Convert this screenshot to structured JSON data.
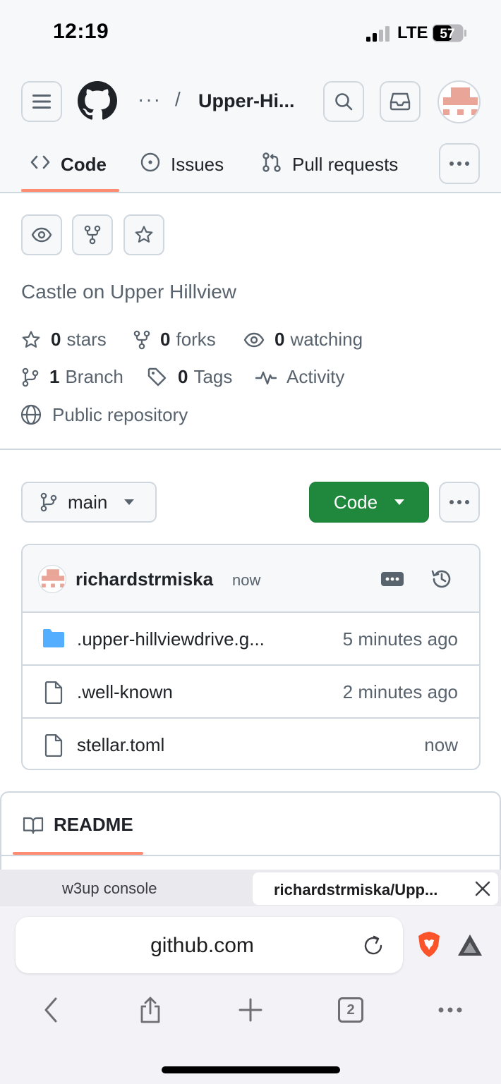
{
  "status_bar": {
    "time": "12:19",
    "network": "LTE",
    "battery": "57"
  },
  "header": {
    "breadcrumb_more": "···",
    "breadcrumb_separator": "/",
    "repo_name": "Upper-Hi..."
  },
  "tabs": [
    {
      "label": "Code",
      "selected": true
    },
    {
      "label": "Issues"
    },
    {
      "label": "Pull requests"
    }
  ],
  "repo": {
    "description": "Castle on Upper Hillview",
    "stars": {
      "count": "0",
      "label": "stars"
    },
    "forks": {
      "count": "0",
      "label": "forks"
    },
    "watching": {
      "count": "0",
      "label": "watching"
    },
    "branches": {
      "count": "1",
      "label": "Branch"
    },
    "tags": {
      "count": "0",
      "label": "Tags"
    },
    "activity_label": "Activity",
    "visibility_label": "Public repository"
  },
  "branch_selector": {
    "label": "main"
  },
  "code_button": {
    "label": "Code",
    "color": "#1f883d"
  },
  "latest_commit": {
    "author": "richardstrmiska",
    "time": "now"
  },
  "files": [
    {
      "name": ".upper-hillviewdrive.g...",
      "time": "5 minutes ago",
      "type": "folder",
      "icon": "folder-icon"
    },
    {
      "name": ".well-known",
      "time": "2 minutes ago",
      "type": "file",
      "icon": "file-icon"
    },
    {
      "name": "stellar.toml",
      "time": "now",
      "type": "file",
      "icon": "file-icon"
    }
  ],
  "readme": {
    "label": "README"
  },
  "browser": {
    "tabs": [
      {
        "title": "w3up console",
        "active": false
      },
      {
        "title": "richardstrmiska/Upp...",
        "active": true
      }
    ],
    "url": "github.com",
    "open_tab_count": "2"
  },
  "colors": {
    "accent_underline": "#fd8c73",
    "folder": "#54aeff",
    "avatar": "#e8a598"
  }
}
